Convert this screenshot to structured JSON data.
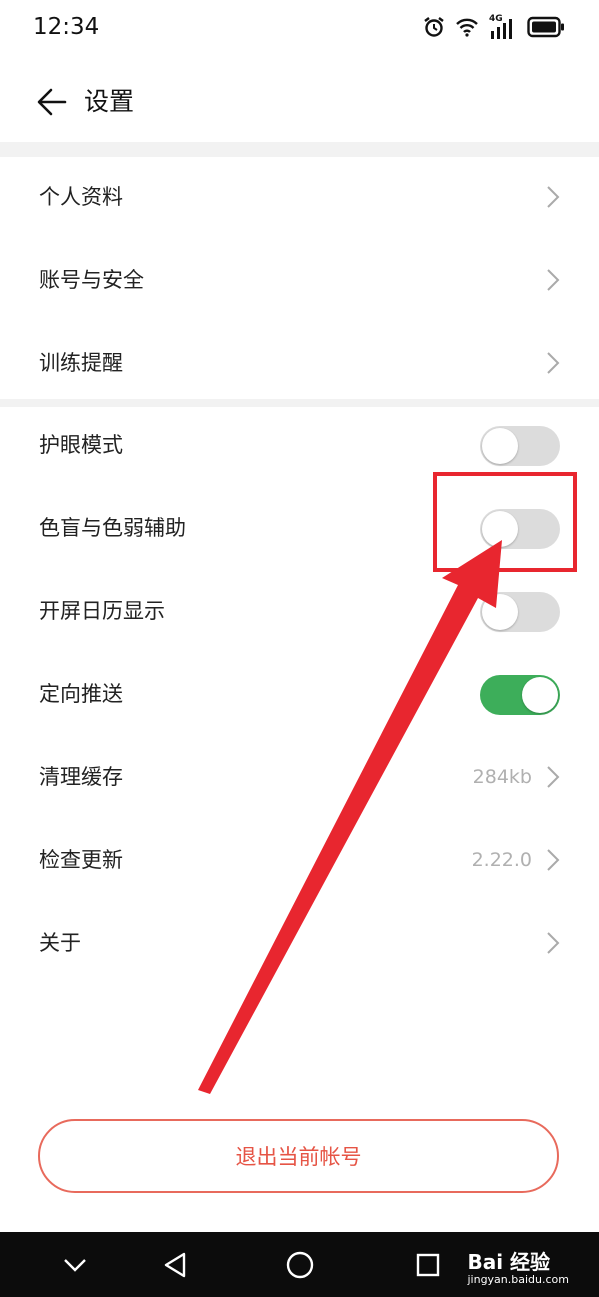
{
  "status_bar": {
    "time": "12:34",
    "network": "4G"
  },
  "header": {
    "title": "设置"
  },
  "settings_group_1": [
    {
      "label": "个人资料"
    },
    {
      "label": "账号与安全"
    },
    {
      "label": "训练提醒"
    }
  ],
  "settings_group_2": [
    {
      "label": "护眼模式",
      "toggle": "off"
    },
    {
      "label": "色盲与色弱辅助",
      "toggle": "off"
    },
    {
      "label": "开屏日历显示",
      "toggle": "off"
    },
    {
      "label": "定向推送",
      "toggle": "on"
    },
    {
      "label": "清理缓存",
      "value": "284kb"
    },
    {
      "label": "检查更新",
      "value": "2.22.0"
    },
    {
      "label": "关于"
    }
  ],
  "logout_button": "退出当前帐号",
  "watermark": {
    "logo": "Bai 经验",
    "url": "jingyan.baidu.com"
  },
  "colors": {
    "accent_red": "#e65445",
    "toggle_on": "#3dae5a",
    "toggle_off": "#dcdcdc",
    "annotation": "#e8262f"
  }
}
